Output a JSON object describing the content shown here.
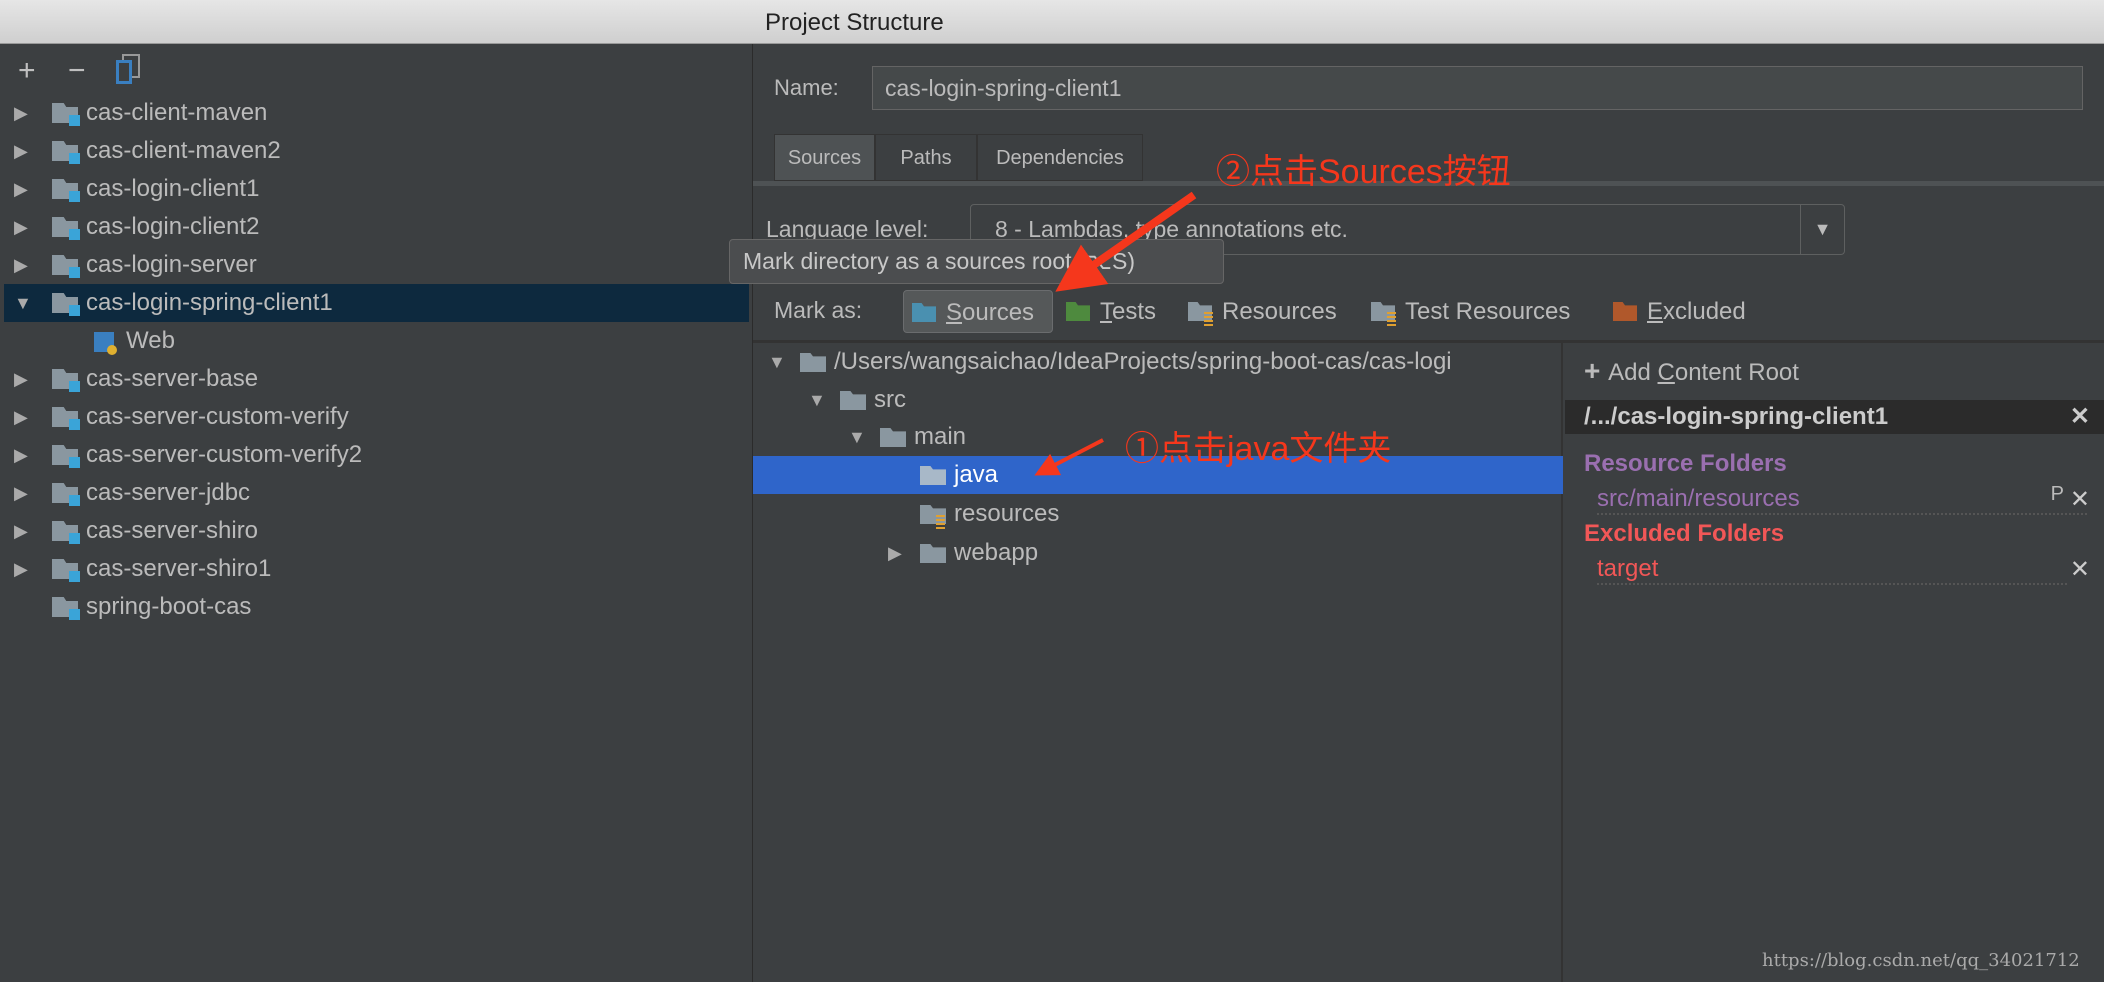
{
  "window": {
    "title": "Project Structure"
  },
  "left_toolbar": {
    "add": "+",
    "remove": "−",
    "copy_icon": "copy-icon"
  },
  "modules": [
    {
      "label": "cas-client-maven",
      "expanded": false
    },
    {
      "label": "cas-client-maven2",
      "expanded": false
    },
    {
      "label": "cas-login-client1",
      "expanded": false
    },
    {
      "label": "cas-login-client2",
      "expanded": false
    },
    {
      "label": "cas-login-server",
      "expanded": false
    },
    {
      "label": "cas-login-spring-client1",
      "expanded": true,
      "selected": true
    },
    {
      "label": "Web",
      "child": true
    },
    {
      "label": "cas-server-base",
      "expanded": false
    },
    {
      "label": "cas-server-custom-verify",
      "expanded": false
    },
    {
      "label": "cas-server-custom-verify2",
      "expanded": false
    },
    {
      "label": "cas-server-jdbc",
      "expanded": false
    },
    {
      "label": "cas-server-shiro",
      "expanded": false
    },
    {
      "label": "cas-server-shiro1",
      "expanded": false
    },
    {
      "label": "spring-boot-cas",
      "leaf": true
    }
  ],
  "name": {
    "label": "Name:",
    "value": "cas-login-spring-client1"
  },
  "tabs": [
    {
      "label": "Sources",
      "active": true
    },
    {
      "label": "Paths"
    },
    {
      "label": "Dependencies"
    }
  ],
  "language": {
    "label": "Language level:",
    "value": "8 - Lambdas, type annotations etc."
  },
  "tooltip": "Mark directory as a sources root (⌥S)",
  "mark_as": {
    "label": "Mark as:",
    "buttons": [
      {
        "pre": "",
        "u": "S",
        "post": "ources",
        "color": "#4a90b0"
      },
      {
        "pre": "",
        "u": "T",
        "post": "ests",
        "color": "#4e8a3e"
      },
      {
        "pre": "Resources",
        "u": "",
        "post": "",
        "color": "#8a97a0"
      },
      {
        "pre": "Test Resources",
        "u": "",
        "post": "",
        "color": "#8a97a0"
      },
      {
        "pre": "",
        "u": "E",
        "post": "xcluded",
        "color": "#b0582b"
      }
    ]
  },
  "tree": [
    {
      "label": "/Users/wangsaichao/IdeaProjects/spring-boot-cas/cas-logi",
      "arrow": "▼"
    },
    {
      "label": "src",
      "arrow": "▼"
    },
    {
      "label": "main",
      "arrow": "▼"
    },
    {
      "label": "java",
      "arrow": "",
      "selected": true
    },
    {
      "label": "resources",
      "arrow": ""
    },
    {
      "label": "webapp",
      "arrow": "▶"
    }
  ],
  "content_roots": {
    "add_pre": "Add ",
    "add_u": "C",
    "add_post": "ontent Root",
    "root": "/.../cas-login-spring-client1",
    "resource_title": "Resource Folders",
    "resource_item": "src/main/resources",
    "resource_prop": "P",
    "excluded_title": "Excluded Folders",
    "excluded_item": "target",
    "resource_color": "#9a6fb0",
    "excluded_color": "#f25757"
  },
  "annotations": {
    "step1": "①点击java文件夹",
    "step2": "②点击Sources按钮",
    "color": "#f5371c"
  },
  "watermark": "https://blog.csdn.net/qq_34021712"
}
